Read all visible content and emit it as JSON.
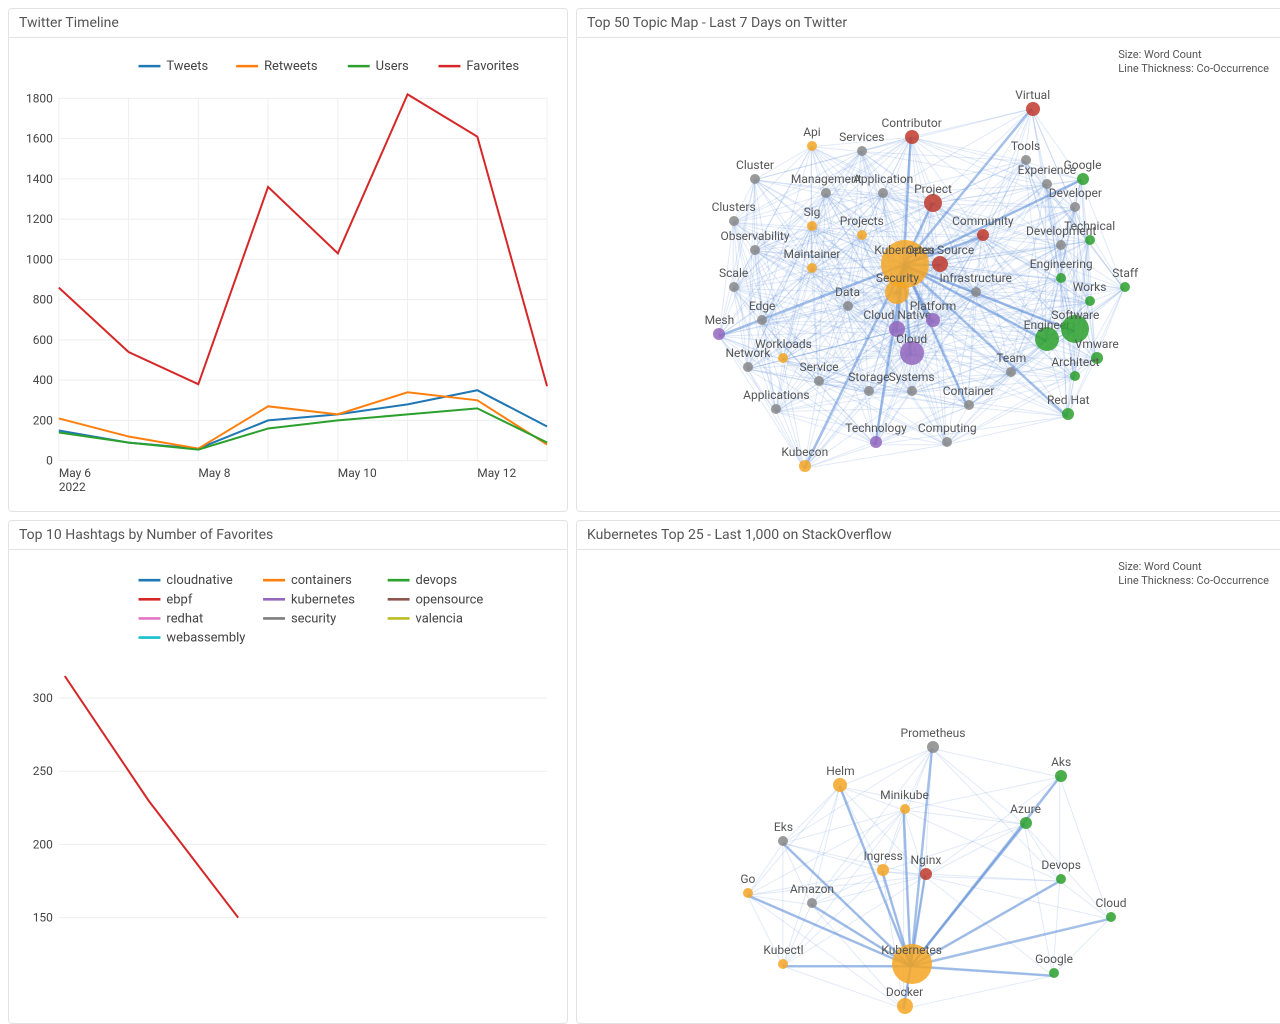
{
  "panels": {
    "timeline": {
      "title": "Twitter Timeline"
    },
    "topicmap": {
      "title": "Top 50 Topic Map - Last 7 Days on Twitter"
    },
    "hashtags": {
      "title": "Top 10 Hashtags by Number of Favorites"
    },
    "stacktop": {
      "title": "Kubernetes Top 25 - Last 1,000 on StackOverflow"
    }
  },
  "netLegend": {
    "l1": "Size: Word Count",
    "l2": "Line Thickness: Co-Occurrence"
  },
  "chart_data": [
    {
      "id": "timeline",
      "type": "line",
      "xlabel": "",
      "ylabel": "",
      "x": [
        "May 6 2022",
        "May 7",
        "May 8",
        "May 9",
        "May 10",
        "May 11",
        "May 12",
        "May 13"
      ],
      "x_ticks_shown": [
        "May 6 2022",
        "May 8",
        "May 10",
        "May 12"
      ],
      "ylim": [
        0,
        1800
      ],
      "y_ticks": [
        0,
        200,
        400,
        600,
        800,
        1000,
        1200,
        1400,
        1600,
        1800
      ],
      "series": [
        {
          "name": "Tweets",
          "color": "#1f77b4",
          "values": [
            150,
            90,
            60,
            200,
            230,
            280,
            350,
            170
          ]
        },
        {
          "name": "Retweets",
          "color": "#ff7f0e",
          "values": [
            210,
            120,
            60,
            270,
            230,
            340,
            300,
            80
          ]
        },
        {
          "name": "Users",
          "color": "#2ca02c",
          "values": [
            140,
            90,
            55,
            160,
            200,
            230,
            260,
            90
          ]
        },
        {
          "name": "Favorites",
          "color": "#d62728",
          "values": [
            860,
            540,
            380,
            1360,
            1030,
            1820,
            1610,
            370
          ]
        }
      ]
    },
    {
      "id": "hashtags",
      "type": "line",
      "xlabel": "",
      "ylabel": "",
      "ylim": [
        0,
        320
      ],
      "y_ticks": [
        150,
        200,
        250,
        300
      ],
      "series_names": [
        "cloudnative",
        "containers",
        "devops",
        "ebpf",
        "kubernetes",
        "opensource",
        "redhat",
        "security",
        "valencia",
        "webassembly"
      ],
      "series_colors": [
        "#1f77b4",
        "#ff7f0e",
        "#2ca02c",
        "#d62728",
        "#9467bd",
        "#8c564b",
        "#e377c2",
        "#7f7f7f",
        "#bcbd22",
        "#17becf"
      ],
      "visible_series": [
        {
          "name": "ebpf",
          "color": "#d62728",
          "values": [
            315,
            230,
            150
          ]
        }
      ]
    },
    {
      "id": "topicmap",
      "type": "network",
      "legend": {
        "size": "Word Count",
        "thickness": "Co-Occurrence"
      },
      "nodes": [
        {
          "label": "Kubernetes",
          "x": 0.46,
          "y": 0.48,
          "r": 24,
          "color": "#f5a623"
        },
        {
          "label": "Security",
          "x": 0.45,
          "y": 0.54,
          "r": 12,
          "color": "#f5a623"
        },
        {
          "label": "Cloud Native",
          "x": 0.45,
          "y": 0.62,
          "r": 8,
          "color": "#9467bd"
        },
        {
          "label": "Cloud",
          "x": 0.47,
          "y": 0.67,
          "r": 12,
          "color": "#9467bd"
        },
        {
          "label": "Platform",
          "x": 0.5,
          "y": 0.6,
          "r": 7,
          "color": "#9467bd"
        },
        {
          "label": "Engineer",
          "x": 0.66,
          "y": 0.64,
          "r": 12,
          "color": "#2ca02c"
        },
        {
          "label": "Software",
          "x": 0.7,
          "y": 0.62,
          "r": 14,
          "color": "#2ca02c"
        },
        {
          "label": "Vmware",
          "x": 0.73,
          "y": 0.68,
          "r": 6,
          "color": "#2ca02c"
        },
        {
          "label": "Architect",
          "x": 0.7,
          "y": 0.72,
          "r": 5,
          "color": "#2ca02c"
        },
        {
          "label": "Red Hat",
          "x": 0.69,
          "y": 0.8,
          "r": 6,
          "color": "#2ca02c"
        },
        {
          "label": "Works",
          "x": 0.72,
          "y": 0.56,
          "r": 5,
          "color": "#2ca02c"
        },
        {
          "label": "Staff",
          "x": 0.77,
          "y": 0.53,
          "r": 5,
          "color": "#2ca02c"
        },
        {
          "label": "Engineering",
          "x": 0.68,
          "y": 0.51,
          "r": 5,
          "color": "#2ca02c"
        },
        {
          "label": "Technical",
          "x": 0.72,
          "y": 0.43,
          "r": 5,
          "color": "#2ca02c"
        },
        {
          "label": "Development",
          "x": 0.68,
          "y": 0.44,
          "r": 5,
          "color": "#888"
        },
        {
          "label": "Google",
          "x": 0.71,
          "y": 0.3,
          "r": 6,
          "color": "#2ca02c"
        },
        {
          "label": "Developer",
          "x": 0.7,
          "y": 0.36,
          "r": 5,
          "color": "#888"
        },
        {
          "label": "Experience",
          "x": 0.66,
          "y": 0.31,
          "r": 5,
          "color": "#888"
        },
        {
          "label": "Tools",
          "x": 0.63,
          "y": 0.26,
          "r": 5,
          "color": "#888"
        },
        {
          "label": "Virtual",
          "x": 0.64,
          "y": 0.15,
          "r": 7,
          "color": "#c0392b"
        },
        {
          "label": "Contributor",
          "x": 0.47,
          "y": 0.21,
          "r": 7,
          "color": "#c0392b"
        },
        {
          "label": "Api",
          "x": 0.33,
          "y": 0.23,
          "r": 5,
          "color": "#f5a623"
        },
        {
          "label": "Services",
          "x": 0.4,
          "y": 0.24,
          "r": 5,
          "color": "#888"
        },
        {
          "label": "Management",
          "x": 0.35,
          "y": 0.33,
          "r": 5,
          "color": "#888"
        },
        {
          "label": "Application",
          "x": 0.43,
          "y": 0.33,
          "r": 5,
          "color": "#888"
        },
        {
          "label": "Project",
          "x": 0.5,
          "y": 0.35,
          "r": 9,
          "color": "#c0392b"
        },
        {
          "label": "Projects",
          "x": 0.4,
          "y": 0.42,
          "r": 5,
          "color": "#f5a623"
        },
        {
          "label": "Sig",
          "x": 0.33,
          "y": 0.4,
          "r": 5,
          "color": "#f5a623"
        },
        {
          "label": "Cluster",
          "x": 0.25,
          "y": 0.3,
          "r": 5,
          "color": "#888"
        },
        {
          "label": "Clusters",
          "x": 0.22,
          "y": 0.39,
          "r": 5,
          "color": "#888"
        },
        {
          "label": "Observability",
          "x": 0.25,
          "y": 0.45,
          "r": 5,
          "color": "#888"
        },
        {
          "label": "Maintainer",
          "x": 0.33,
          "y": 0.49,
          "r": 5,
          "color": "#f5a623"
        },
        {
          "label": "Open Source",
          "x": 0.51,
          "y": 0.48,
          "r": 8,
          "color": "#c0392b"
        },
        {
          "label": "Community",
          "x": 0.57,
          "y": 0.42,
          "r": 6,
          "color": "#c0392b"
        },
        {
          "label": "Infrastructure",
          "x": 0.56,
          "y": 0.54,
          "r": 5,
          "color": "#888"
        },
        {
          "label": "Data",
          "x": 0.38,
          "y": 0.57,
          "r": 5,
          "color": "#888"
        },
        {
          "label": "Scale",
          "x": 0.22,
          "y": 0.53,
          "r": 5,
          "color": "#888"
        },
        {
          "label": "Edge",
          "x": 0.26,
          "y": 0.6,
          "r": 5,
          "color": "#888"
        },
        {
          "label": "Mesh",
          "x": 0.2,
          "y": 0.63,
          "r": 6,
          "color": "#9467bd"
        },
        {
          "label": "Workloads",
          "x": 0.29,
          "y": 0.68,
          "r": 5,
          "color": "#f5a623"
        },
        {
          "label": "Network",
          "x": 0.24,
          "y": 0.7,
          "r": 5,
          "color": "#888"
        },
        {
          "label": "Service",
          "x": 0.34,
          "y": 0.73,
          "r": 5,
          "color": "#888"
        },
        {
          "label": "Applications",
          "x": 0.28,
          "y": 0.79,
          "r": 5,
          "color": "#888"
        },
        {
          "label": "Storage",
          "x": 0.41,
          "y": 0.75,
          "r": 5,
          "color": "#888"
        },
        {
          "label": "Systems",
          "x": 0.47,
          "y": 0.75,
          "r": 5,
          "color": "#888"
        },
        {
          "label": "Container",
          "x": 0.55,
          "y": 0.78,
          "r": 5,
          "color": "#888"
        },
        {
          "label": "Team",
          "x": 0.61,
          "y": 0.71,
          "r": 5,
          "color": "#888"
        },
        {
          "label": "Technology",
          "x": 0.42,
          "y": 0.86,
          "r": 6,
          "color": "#9467bd"
        },
        {
          "label": "Computing",
          "x": 0.52,
          "y": 0.86,
          "r": 5,
          "color": "#888"
        },
        {
          "label": "Kubecon",
          "x": 0.32,
          "y": 0.91,
          "r": 6,
          "color": "#f5a623"
        }
      ],
      "strong_edges_from": "Kubernetes",
      "strong_edge_targets": [
        "Security",
        "Cloud",
        "Cloud Native",
        "Engineer",
        "Software",
        "Project",
        "Open Source",
        "Community",
        "Virtual",
        "Contributor",
        "Mesh",
        "Platform",
        "Google",
        "Technology",
        "Kubecon",
        "Red Hat",
        "Container"
      ]
    },
    {
      "id": "stacktop",
      "type": "network",
      "legend": {
        "size": "Word Count",
        "thickness": "Co-Occurrence"
      },
      "nodes": [
        {
          "label": "Kubernetes",
          "x": 0.47,
          "y": 0.88,
          "r": 20,
          "color": "#f5a623"
        },
        {
          "label": "Docker",
          "x": 0.46,
          "y": 0.97,
          "r": 8,
          "color": "#f5a623"
        },
        {
          "label": "Helm",
          "x": 0.37,
          "y": 0.5,
          "r": 7,
          "color": "#f5a623"
        },
        {
          "label": "Prometheus",
          "x": 0.5,
          "y": 0.42,
          "r": 6,
          "color": "#888"
        },
        {
          "label": "Aks",
          "x": 0.68,
          "y": 0.48,
          "r": 6,
          "color": "#2ca02c"
        },
        {
          "label": "Azure",
          "x": 0.63,
          "y": 0.58,
          "r": 6,
          "color": "#2ca02c"
        },
        {
          "label": "Devops",
          "x": 0.68,
          "y": 0.7,
          "r": 5,
          "color": "#2ca02c"
        },
        {
          "label": "Cloud",
          "x": 0.75,
          "y": 0.78,
          "r": 5,
          "color": "#2ca02c"
        },
        {
          "label": "Google",
          "x": 0.67,
          "y": 0.9,
          "r": 5,
          "color": "#2ca02c"
        },
        {
          "label": "Minikube",
          "x": 0.46,
          "y": 0.55,
          "r": 5,
          "color": "#f5a623"
        },
        {
          "label": "Ingress",
          "x": 0.43,
          "y": 0.68,
          "r": 6,
          "color": "#f5a623"
        },
        {
          "label": "Nginx",
          "x": 0.49,
          "y": 0.69,
          "r": 6,
          "color": "#c0392b"
        },
        {
          "label": "Eks",
          "x": 0.29,
          "y": 0.62,
          "r": 5,
          "color": "#888"
        },
        {
          "label": "Amazon",
          "x": 0.33,
          "y": 0.75,
          "r": 5,
          "color": "#888"
        },
        {
          "label": "Go",
          "x": 0.24,
          "y": 0.73,
          "r": 5,
          "color": "#f5a623"
        },
        {
          "label": "Kubectl",
          "x": 0.29,
          "y": 0.88,
          "r": 5,
          "color": "#f5a623"
        }
      ],
      "strong_edges_from": "Kubernetes",
      "strong_edge_targets": [
        "Docker",
        "Helm",
        "Prometheus",
        "Aks",
        "Azure",
        "Devops",
        "Cloud",
        "Google",
        "Minikube",
        "Ingress",
        "Nginx",
        "Eks",
        "Amazon",
        "Go",
        "Kubectl"
      ]
    }
  ]
}
